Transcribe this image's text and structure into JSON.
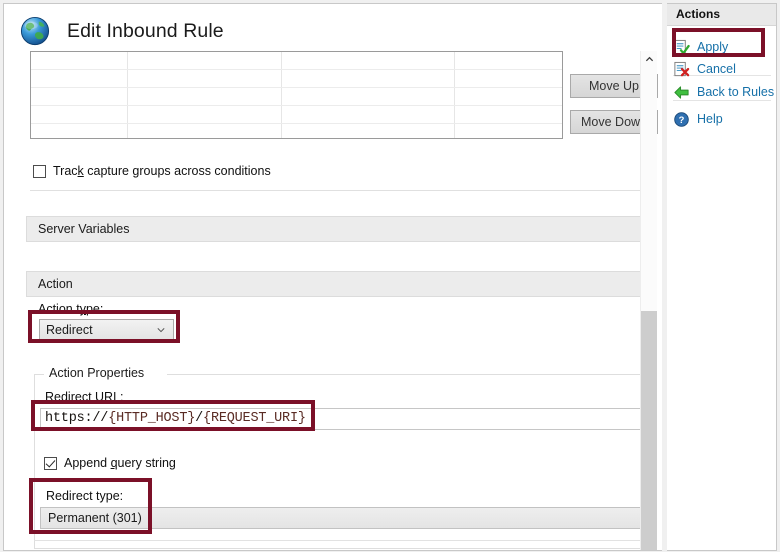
{
  "window": {
    "title": "Edit Inbound Rule",
    "title_icon": "globe-icon"
  },
  "conditions": {
    "move_up_label": "Move Up",
    "move_down_label": "Move Down",
    "track_capture_label_prefix": "Trac",
    "track_capture_accel": "k",
    "track_capture_label_suffix": " capture groups across conditions",
    "track_capture_checked": false,
    "grid_columns": 4,
    "grid_rows": 5
  },
  "sections": {
    "server_variables": "Server Variables",
    "action": "Action"
  },
  "action": {
    "type_label_prefix": "Action t",
    "type_label_accel": "y",
    "type_label_suffix": "pe:",
    "type_value": "Redirect",
    "type_options": [
      "Redirect"
    ],
    "properties_legend": "Action Properties",
    "redirect_url_label": "Redirect URL:",
    "redirect_url_value": "https://{HTTP_HOST}/{REQUEST_URI}",
    "redirect_url_parts": [
      {
        "text": "https://",
        "kind": "plain"
      },
      {
        "text": "{HTTP_HOST}",
        "kind": "brace"
      },
      {
        "text": "/",
        "kind": "plain"
      },
      {
        "text": "{REQUEST_URI}",
        "kind": "brace"
      }
    ],
    "append_query_prefix": "Append ",
    "append_query_accel": "q",
    "append_query_suffix": "uery string",
    "append_query_checked": true,
    "redirect_type_label": "Redirect type:",
    "redirect_type_value": "Permanent (301)",
    "redirect_type_options": [
      "Permanent (301)"
    ]
  },
  "actions_pane": {
    "header": "Actions",
    "items": [
      {
        "label": "Apply",
        "icon": "apply-document-check-icon"
      },
      {
        "label": "Cancel",
        "icon": "cancel-document-x-icon"
      },
      {
        "label": "Back to Rules",
        "icon": "back-arrow-icon"
      },
      {
        "label": "Help",
        "icon": "help-question-icon"
      }
    ]
  },
  "scrollbar": {
    "up_arrow": "chevron-up-icon",
    "thumb_position_percent": 52
  },
  "colors": {
    "annotation": "#7b1028",
    "link": "#1670a8",
    "section_bar": "#ececec",
    "button_face": "#dcdcdc"
  }
}
